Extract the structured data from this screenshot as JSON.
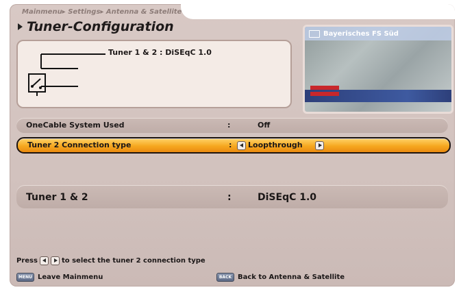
{
  "breadcrumb": "Mainmenu▸ Settings▸ Antenna & Satellite",
  "title": "Tuner-Configuration",
  "diagram": {
    "label": "Tuner 1 & 2 : DiSEqC 1.0"
  },
  "preview": {
    "channel": "Bayerisches FS Süd"
  },
  "rows": [
    {
      "label": "OneCable System Used",
      "colon": ":",
      "value": "Off"
    },
    {
      "label": "Tuner 2 Connection type",
      "colon": ":",
      "value": "Loopthrough"
    },
    {
      "label": "Tuner 1 & 2",
      "colon": ":",
      "value": "DiSEqC 1.0"
    }
  ],
  "hint": {
    "prefix": "Press",
    "suffix": "to select the tuner 2 connection type"
  },
  "footer": {
    "left_key": "MENU",
    "left_label": "Leave Mainmenu",
    "right_key": "BACK",
    "right_label": "Back to Antenna & Satellite"
  },
  "colors": {
    "selected_highlight": "#f6a820",
    "panel_background": "#d2c2be"
  }
}
